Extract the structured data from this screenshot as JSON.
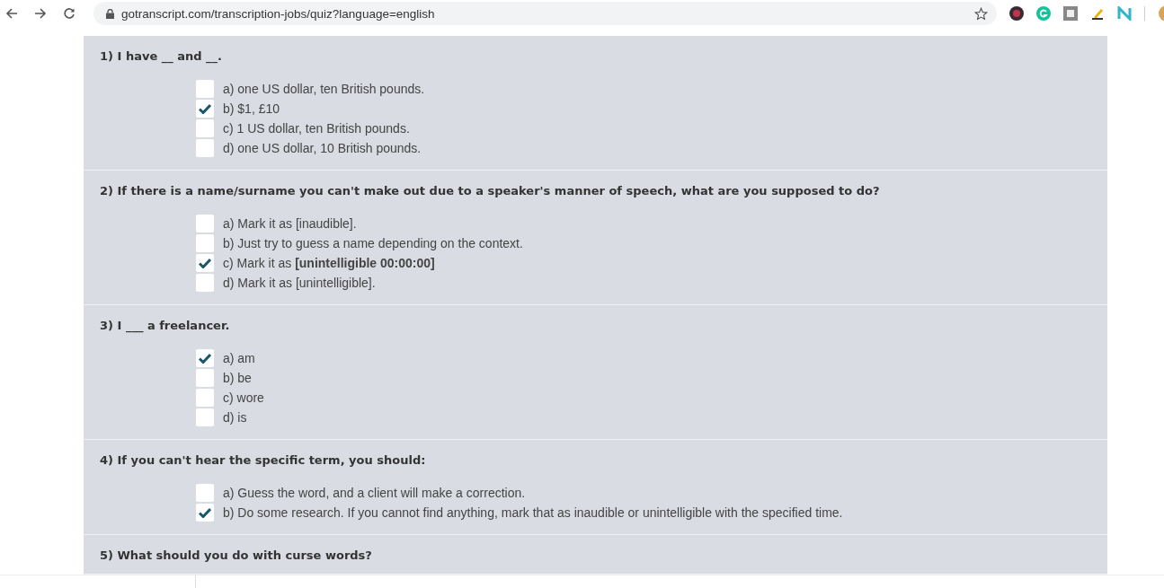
{
  "browser": {
    "url": "gotranscript.com/transcription-jobs/quiz?language=english"
  },
  "questions": [
    {
      "text": "1) I have __ and __.",
      "options": [
        {
          "label": "a) one US dollar, ten British pounds.",
          "checked": false
        },
        {
          "label": "b) $1, £10",
          "checked": true
        },
        {
          "label": "c) 1 US dollar, ten British pounds.",
          "checked": false
        },
        {
          "label": "d) one US dollar, 10 British pounds.",
          "checked": false
        }
      ]
    },
    {
      "text": "2) If there is a name/surname you can't make out due to a speaker's manner of speech, what are you supposed to do?",
      "options": [
        {
          "label": "a) Mark it as [inaudible].",
          "checked": false
        },
        {
          "label": "b) Just try to guess a name depending on the context.",
          "checked": false
        },
        {
          "label": "c) Mark it as **[unintelligible 00:00:00]**",
          "checked": true
        },
        {
          "label": "d) Mark it as [unintelligible].",
          "checked": false
        }
      ]
    },
    {
      "text": "3) I ___ a freelancer.",
      "options": [
        {
          "label": "a) am",
          "checked": true
        },
        {
          "label": "b) be",
          "checked": false
        },
        {
          "label": "c) wore",
          "checked": false
        },
        {
          "label": "d) is",
          "checked": false
        }
      ]
    },
    {
      "text": "4) If you can't hear the specific term, you should:",
      "options": [
        {
          "label": "a) Guess the word, and a client will make a correction.",
          "checked": false
        },
        {
          "label": "b) Do some research. If you cannot find anything, mark that as inaudible or unintelligible with the specified time.",
          "checked": true
        }
      ]
    },
    {
      "text": "5) What should you do with curse words?"
    }
  ]
}
